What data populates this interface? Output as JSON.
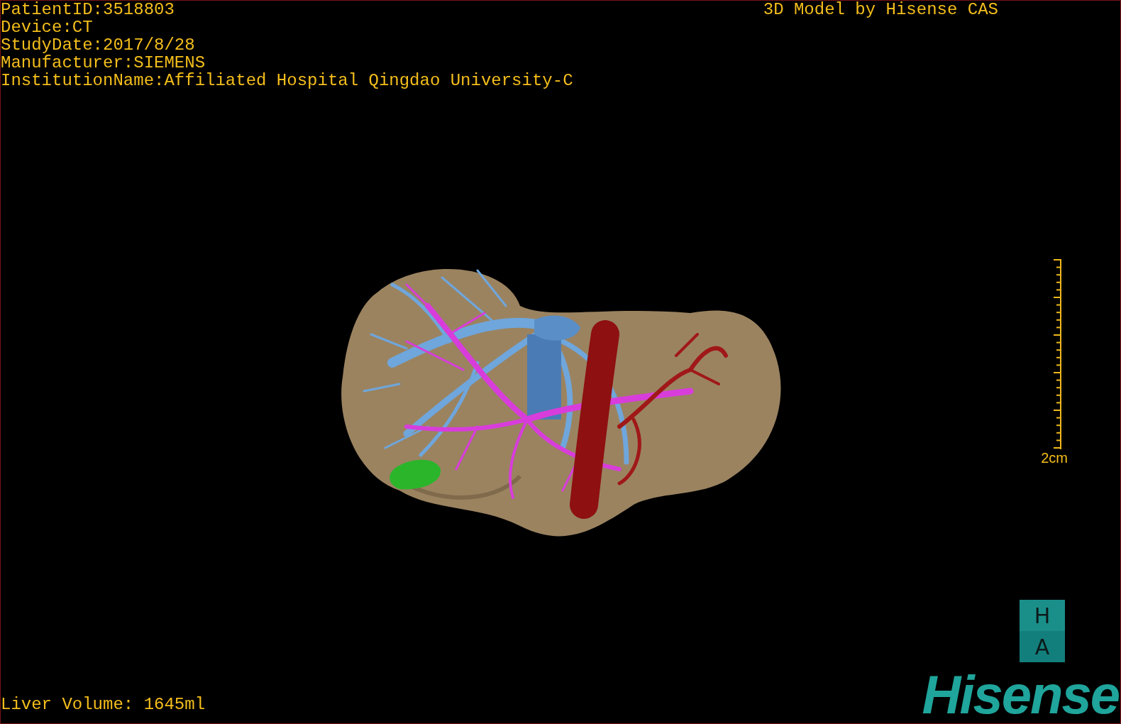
{
  "study_info": [
    "PatientID:3518803",
    "Device:CT",
    "StudyDate:2017/8/28",
    "Manufacturer:SIEMENS",
    "InstitutionName:Affiliated Hospital Qingdao University-C"
  ],
  "title": "3D Model by Hisense CAS",
  "scale_bar": {
    "label": "2cm"
  },
  "orientation_cube": {
    "top": "H",
    "bottom": "A"
  },
  "liver_volume": "Liver Volume: 1645ml",
  "logo": "Hisense"
}
